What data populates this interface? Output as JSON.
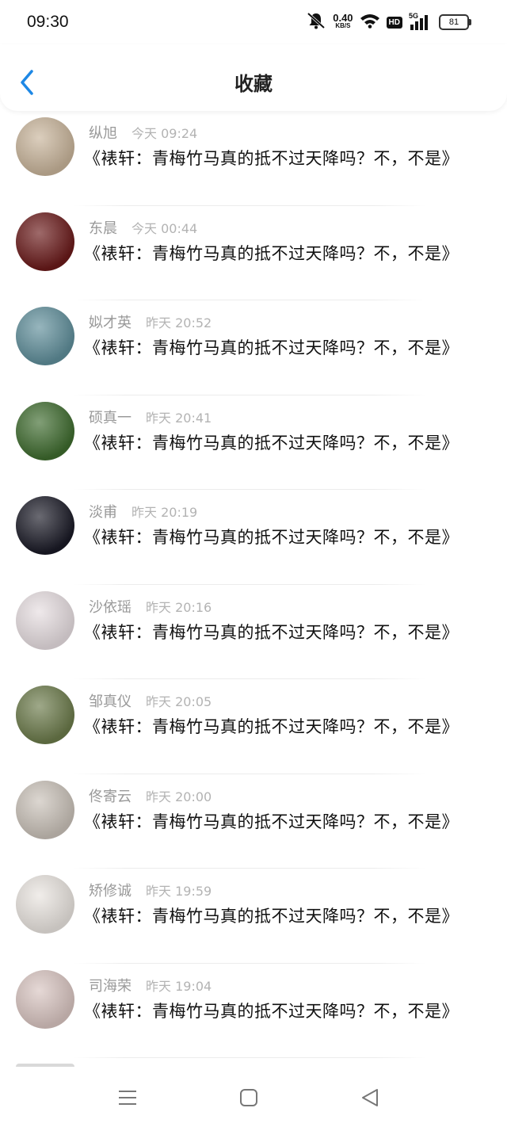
{
  "status_bar": {
    "time": "09:30",
    "net_speed_value": "0.40",
    "net_speed_unit": "KB/S",
    "hd_label": "HD",
    "network_label": "5G",
    "battery": "81",
    "icons": [
      "mute-bell-icon",
      "wifi-icon",
      "hd-icon",
      "signal-icon",
      "battery-icon"
    ]
  },
  "header": {
    "title": "收藏",
    "back_icon": "chevron-left-icon",
    "accent_color": "#1e88e5"
  },
  "favorites": [
    {
      "name": "纵旭",
      "time": "今天 09:24",
      "text": "《裱轩：青梅竹马真的抵不过天降吗？不，不是》",
      "avatar_color": "#c8b49a"
    },
    {
      "name": "东晨",
      "time": "今天 00:44",
      "text": "《裱轩：青梅竹马真的抵不过天降吗？不，不是》",
      "avatar_color": "#6a1a1a"
    },
    {
      "name": "姒才英",
      "time": "昨天 20:52",
      "text": "《裱轩：青梅竹马真的抵不过天降吗？不，不是》",
      "avatar_color": "#5f8e9a"
    },
    {
      "name": "硕真一",
      "time": "昨天 20:41",
      "text": "《裱轩：青梅竹马真的抵不过天降吗？不，不是》",
      "avatar_color": "#3e6b2e"
    },
    {
      "name": "淡甫",
      "time": "昨天 20:19",
      "text": "《裱轩：青梅竹马真的抵不过天降吗？不，不是》",
      "avatar_color": "#1a1a26"
    },
    {
      "name": "沙依瑶",
      "time": "昨天 20:16",
      "text": "《裱轩：青梅竹马真的抵不过天降吗？不，不是》",
      "avatar_color": "#e6dde0"
    },
    {
      "name": "邹真仪",
      "time": "昨天 20:05",
      "text": "《裱轩：青梅竹马真的抵不过天降吗？不，不是》",
      "avatar_color": "#6b7a4a"
    },
    {
      "name": "佟寄云",
      "time": "昨天 20:00",
      "text": "《裱轩：青梅竹马真的抵不过天降吗？不，不是》",
      "avatar_color": "#c9c1b8"
    },
    {
      "name": "矫修诚",
      "time": "昨天 19:59",
      "text": "《裱轩：青梅竹马真的抵不过天降吗？不，不是》",
      "avatar_color": "#e9e4df"
    },
    {
      "name": "司海荣",
      "time": "昨天 19:04",
      "text": "《裱轩：青梅竹马真的抵不过天降吗？不，不是》",
      "avatar_color": "#d8c4c0"
    }
  ],
  "nav_bar": {
    "icons": [
      "menu-icon",
      "home-square-icon",
      "back-triangle-icon"
    ]
  }
}
